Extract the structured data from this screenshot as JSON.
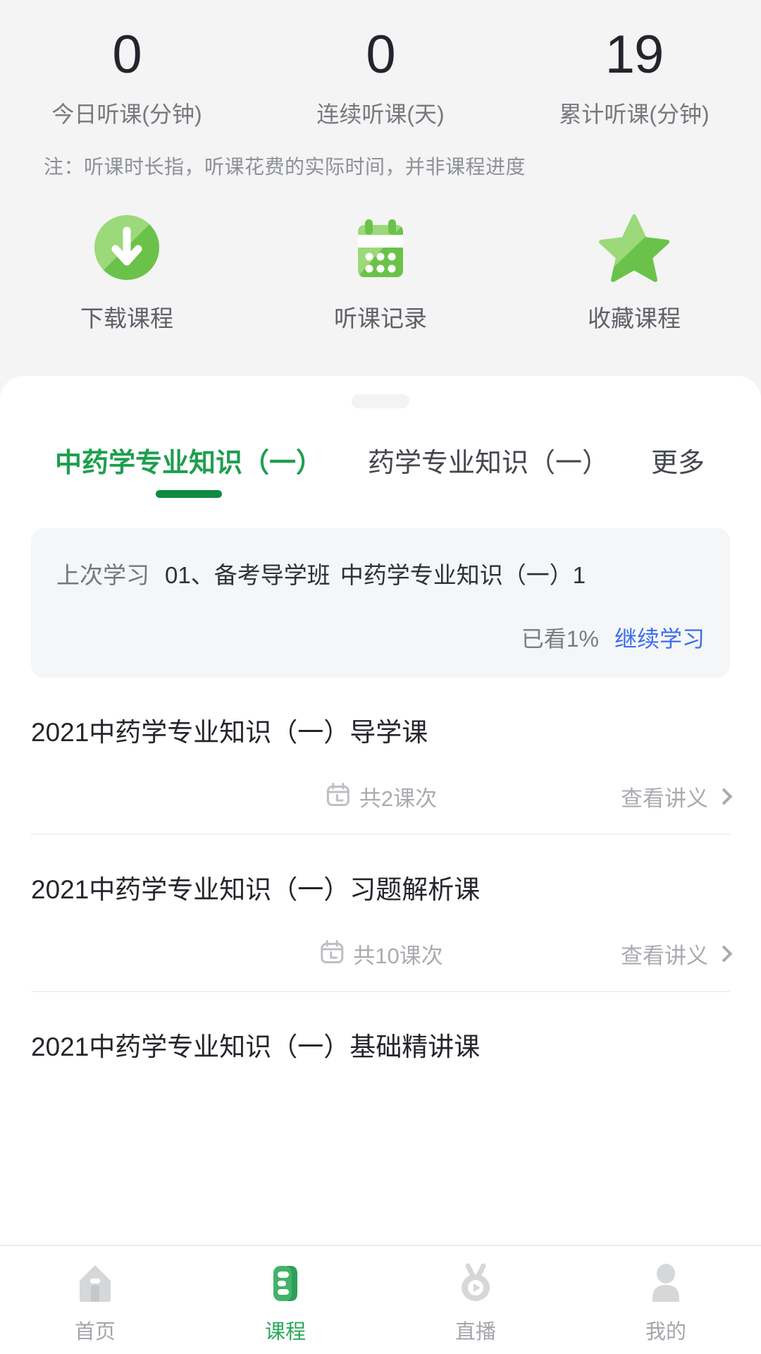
{
  "stats": {
    "items": [
      {
        "value": "0",
        "label": "今日听课(分钟)"
      },
      {
        "value": "0",
        "label": "连续听课(天)"
      },
      {
        "value": "19",
        "label": "累计听课(分钟)"
      }
    ],
    "note": "注：听课时长指，听课花费的实际时间，并非课程进度"
  },
  "actions": [
    {
      "label": "下载课程",
      "icon": "download-circle-icon"
    },
    {
      "label": "听课记录",
      "icon": "calendar-records-icon"
    },
    {
      "label": "收藏课程",
      "icon": "star-favorite-icon"
    }
  ],
  "tabs": [
    {
      "label": "中药学专业知识（一）",
      "active": true
    },
    {
      "label": "药学专业知识（一）",
      "active": false
    },
    {
      "label": "更多",
      "active": false
    }
  ],
  "last_study": {
    "prefix": "上次学习",
    "chapter": "01、备考导学班",
    "course": "中药学专业知识（一）1",
    "progress": "已看1%",
    "continue_label": "继续学习"
  },
  "courses": [
    {
      "title": "2021中药学专业知识（一）导学课",
      "count": "共2课次",
      "link": "查看讲义"
    },
    {
      "title": "2021中药学专业知识（一）习题解析课",
      "count": "共10课次",
      "link": "查看讲义"
    },
    {
      "title": "2021中药学专业知识（一）基础精讲课",
      "count": "",
      "link": ""
    }
  ],
  "bottom_nav": [
    {
      "label": "首页",
      "icon": "home-icon",
      "active": false
    },
    {
      "label": "课程",
      "icon": "book-icon",
      "active": true
    },
    {
      "label": "直播",
      "icon": "live-icon",
      "active": false
    },
    {
      "label": "我的",
      "icon": "person-icon",
      "active": false
    }
  ],
  "colors": {
    "brand_green": "#2aa85a",
    "tab_active_green": "#1d9f4e",
    "underline_green": "#0f8b42",
    "link_blue": "#3b6ef0",
    "page_bg": "#f4f4f4"
  }
}
